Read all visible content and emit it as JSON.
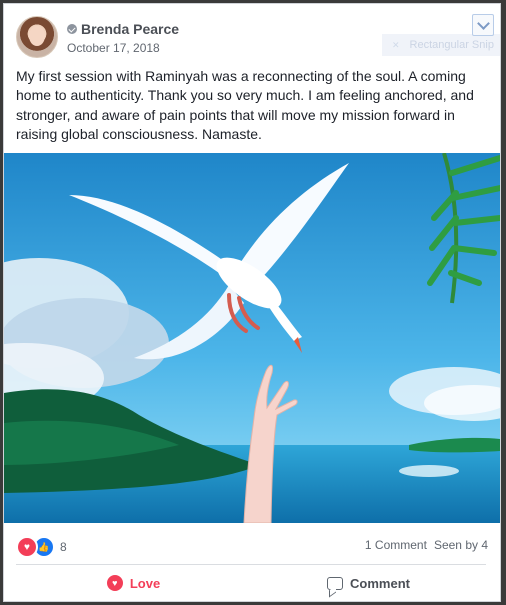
{
  "post": {
    "author": "Brenda Pearce",
    "date": "October 17, 2018",
    "text": "My first session with Raminyah was a reconnecting of the soul. A coming home to authenticity. Thank you so very much. I am feeling anchored, and stronger, and aware of pain points that will move my mission forward in raising global consciousness. Namaste.",
    "overlay_label": "Rectangular Snip"
  },
  "icons": {
    "avatar": "avatar",
    "badge": "verified-check-icon",
    "menu": "chevron-down-icon",
    "love": "heart-icon",
    "like": "thumbs-up-icon",
    "comment": "comment-bubble-icon"
  },
  "stats": {
    "reaction_count": "8",
    "comments": "1 Comment",
    "seen": "Seen by 4"
  },
  "actions": {
    "love_label": "Love",
    "comment_label": "Comment"
  },
  "colors": {
    "love": "#f33e58",
    "like": "#1877f2",
    "text": "#1d2129",
    "muted": "#606770"
  }
}
